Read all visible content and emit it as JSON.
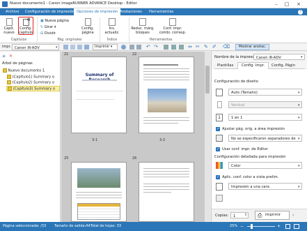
{
  "window": {
    "title": "Nuevo documento1 - Canon imageRUNNER ADVANCE Desktop - Editor"
  },
  "menu": {
    "tabs": [
      "Archivo",
      "Configuración de impresión",
      "Opciones de impresión",
      "Anotaciones",
      "Herramientas"
    ]
  },
  "ribbon": {
    "capitulo": {
      "nuevo": "Capít. nuevo",
      "config": "Config. capítulo",
      "group": "Capítulos"
    },
    "pag": {
      "nueva": "Nueva página",
      "girar": "Girar",
      "dividir": "Dividir",
      "config": "Config. página",
      "group": "Pág. originales"
    },
    "indice": {
      "label": "Ins. actualiz.",
      "group": "Índice"
    },
    "herr": {
      "reduc": "Reduc. márg. bloques",
      "conf": "Conf. impr. combi. corresp.",
      "group": "Herramientas"
    }
  },
  "toolbar": {
    "impr_label": "Impr.",
    "printer": "Canon iR-ADV",
    "imprimir": "Imprimir",
    "zoom": "Zoom",
    "mostrar": "Mostrar anotac."
  },
  "tree": {
    "heading": "Árbol de páginas",
    "items": [
      "Nuevo documento 1",
      "(Capítulo1) Summary o",
      "(Capítulo2) Summary o",
      "(Capítulo3) Summary o"
    ]
  },
  "pages": {
    "top_left_num": "21",
    "top_right_num": "22",
    "p1": {
      "title": "Summary of Research",
      "label": "3-1"
    },
    "p2": {
      "label": "3-2"
    },
    "bottom_left_num": "25",
    "bottom_right_num": "26"
  },
  "settings": {
    "printer_label": "Nombre de la impresora:",
    "printer": "Canon iR-ADV",
    "tabs": [
      "Plantillas",
      "Config. Impr.",
      "Config. Págin"
    ],
    "section_layout": "Configuración de diseño",
    "auto": "Auto (Tamaño)",
    "vertical": "Vertical",
    "one_in_one": "1 en 1",
    "ajustar": "Ajustar pág. orig. a área impresión",
    "separadores": "No se especificaron separadores de c",
    "usar": "Usar conf. impr. de Editor",
    "section_detail": "Configuración detallada para impresión",
    "color": "Color",
    "aplic": "Aplic. conf. color a vista prelim.",
    "cara": "Impresión a una cara",
    "copias_label": "Copias:",
    "copias": "1",
    "imprimir": "Imprimir"
  },
  "status": {
    "selected": "Página seleccionada: /33",
    "tamano": "Tamaño de salida:A4",
    "total": "Total de hojas: 33",
    "zoom": "25%"
  },
  "colors": {
    "accent": "#2a76b8",
    "highlight_red": "#e02020"
  }
}
